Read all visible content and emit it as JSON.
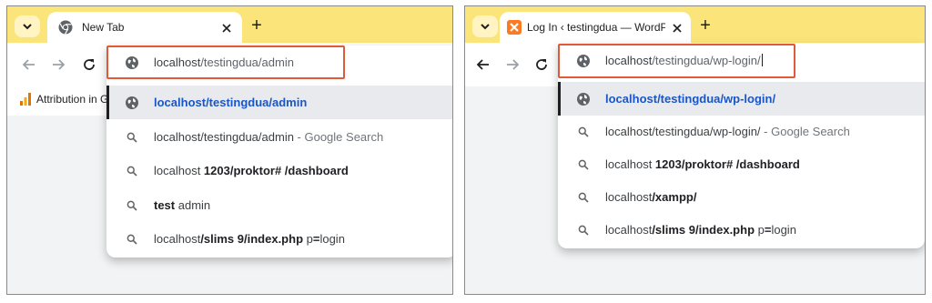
{
  "left": {
    "tab": {
      "title": "New Tab"
    },
    "new_tab_symbol": "+",
    "bookmark": {
      "label": "Attribution in G"
    },
    "omnibox": {
      "host": "localhost",
      "path": "/testingdua/admin"
    },
    "suggestions": [
      {
        "icon": "globe-icon",
        "parts": [
          {
            "t": "localhost/testingdua/admin",
            "s": "link"
          }
        ]
      },
      {
        "icon": "search-icon",
        "parts": [
          {
            "t": "localhost/testingdua/admin",
            "s": ""
          },
          {
            "t": " - Google Search",
            "s": "muted"
          }
        ]
      },
      {
        "icon": "search-icon",
        "parts": [
          {
            "t": "localhost ",
            "s": ""
          },
          {
            "t": "1203/proktor# /dashboard",
            "s": "b"
          }
        ]
      },
      {
        "icon": "search-icon",
        "parts": [
          {
            "t": "test",
            "s": "b"
          },
          {
            "t": " admin",
            "s": ""
          }
        ]
      },
      {
        "icon": "search-icon",
        "parts": [
          {
            "t": "localhost",
            "s": ""
          },
          {
            "t": "/slims 9/index.php ",
            "s": "b"
          },
          {
            "t": "p",
            "s": ""
          },
          {
            "t": "=",
            "s": "b"
          },
          {
            "t": "login",
            "s": ""
          }
        ]
      }
    ]
  },
  "right": {
    "tab": {
      "title": "Log In ‹ testingdua — WordPress"
    },
    "new_tab_symbol": "+",
    "omnibox": {
      "host": "localhost",
      "path": "/testingdua/wp-login/"
    },
    "suggestions": [
      {
        "icon": "globe-icon",
        "parts": [
          {
            "t": "localhost/testingdua/wp-login/",
            "s": "link"
          }
        ]
      },
      {
        "icon": "search-icon",
        "parts": [
          {
            "t": "localhost/testingdua/wp-login/",
            "s": ""
          },
          {
            "t": " - Google Search",
            "s": "muted"
          }
        ]
      },
      {
        "icon": "search-icon",
        "parts": [
          {
            "t": "localhost ",
            "s": ""
          },
          {
            "t": "1203/proktor# /dashboard",
            "s": "b"
          }
        ]
      },
      {
        "icon": "search-icon",
        "parts": [
          {
            "t": "localhost",
            "s": ""
          },
          {
            "t": "/xampp/",
            "s": "b"
          }
        ]
      },
      {
        "icon": "search-icon",
        "parts": [
          {
            "t": "localhost",
            "s": ""
          },
          {
            "t": "/slims 9/index.php ",
            "s": "b"
          },
          {
            "t": "p",
            "s": ""
          },
          {
            "t": "=",
            "s": "b"
          },
          {
            "t": "login",
            "s": ""
          }
        ]
      }
    ]
  },
  "colors": {
    "tabstrip": "#fbe57a",
    "highlight_box": "#e05a3a",
    "suggestion_link": "#1a56c6"
  }
}
